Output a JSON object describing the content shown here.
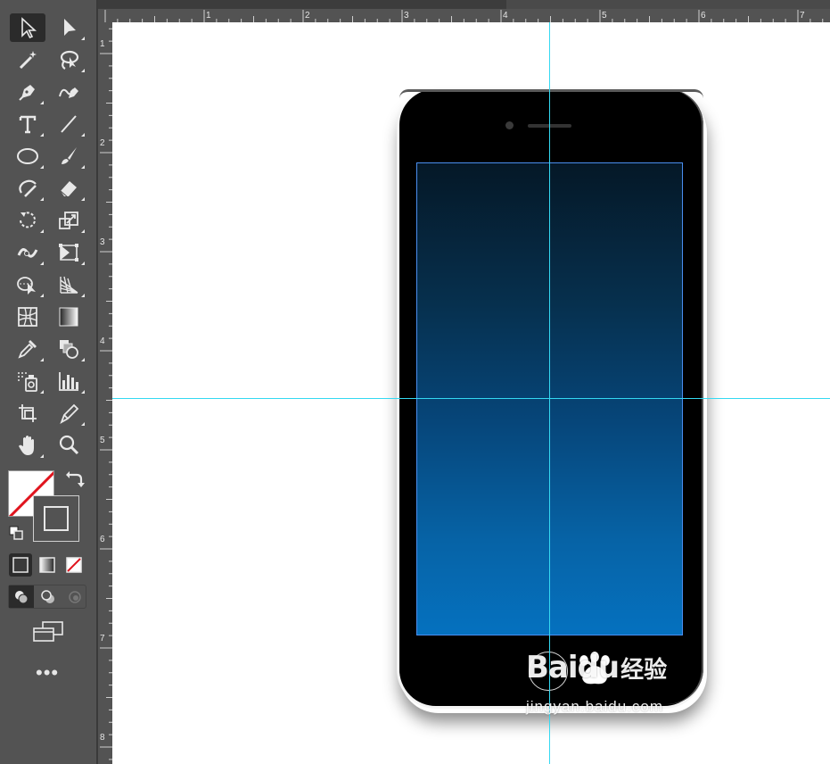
{
  "toolbar": {
    "tools": [
      {
        "name": "selection-tool",
        "icon": "selection-arrow-icon",
        "active": true
      },
      {
        "name": "direct-selection-tool",
        "icon": "direct-selection-arrow-icon"
      },
      {
        "name": "magic-wand-tool",
        "icon": "magic-wand-icon"
      },
      {
        "name": "lasso-tool",
        "icon": "lasso-icon"
      },
      {
        "name": "pen-tool",
        "icon": "pen-icon"
      },
      {
        "name": "curvature-tool",
        "icon": "curvature-pen-icon"
      },
      {
        "name": "type-tool",
        "icon": "type-icon"
      },
      {
        "name": "line-segment-tool",
        "icon": "line-segment-icon"
      },
      {
        "name": "ellipse-tool",
        "icon": "ellipse-icon"
      },
      {
        "name": "paintbrush-tool",
        "icon": "paintbrush-icon"
      },
      {
        "name": "shaper-tool",
        "icon": "shaper-icon"
      },
      {
        "name": "eraser-tool",
        "icon": "eraser-icon"
      },
      {
        "name": "rotate-tool",
        "icon": "rotate-icon"
      },
      {
        "name": "scale-tool",
        "icon": "scale-icon"
      },
      {
        "name": "width-tool",
        "icon": "width-icon"
      },
      {
        "name": "free-transform-tool",
        "icon": "free-transform-icon"
      },
      {
        "name": "shape-builder-tool",
        "icon": "shape-builder-icon"
      },
      {
        "name": "perspective-grid-tool",
        "icon": "perspective-grid-icon"
      },
      {
        "name": "mesh-tool",
        "icon": "mesh-icon"
      },
      {
        "name": "gradient-tool",
        "icon": "gradient-icon"
      },
      {
        "name": "eyedropper-tool",
        "icon": "eyedropper-icon"
      },
      {
        "name": "blend-tool",
        "icon": "blend-icon"
      },
      {
        "name": "symbol-sprayer-tool",
        "icon": "symbol-sprayer-icon"
      },
      {
        "name": "column-graph-tool",
        "icon": "column-graph-icon"
      },
      {
        "name": "artboard-tool",
        "icon": "artboard-icon"
      },
      {
        "name": "slice-tool",
        "icon": "slice-icon"
      },
      {
        "name": "hand-tool",
        "icon": "hand-icon"
      },
      {
        "name": "zoom-tool",
        "icon": "zoom-icon"
      }
    ],
    "fill_color": "none",
    "stroke_color": "none",
    "more_label": "•••"
  },
  "rulers": {
    "top_numbers": [
      "1",
      "2",
      "3",
      "4",
      "5",
      "6",
      "7"
    ],
    "left_numbers": [
      "1",
      "2",
      "3",
      "4",
      "5",
      "6",
      "7",
      "8"
    ]
  },
  "canvas": {
    "guide_color": "#34d9f2",
    "phone": {
      "body_color": "#000000",
      "screen_gradient_top": "#051827",
      "screen_gradient_bottom": "#0571bf"
    }
  },
  "watermark": {
    "brand": "Bai",
    "brand2": "du",
    "cn": "经验",
    "url": "jingyan.baidu.com"
  }
}
